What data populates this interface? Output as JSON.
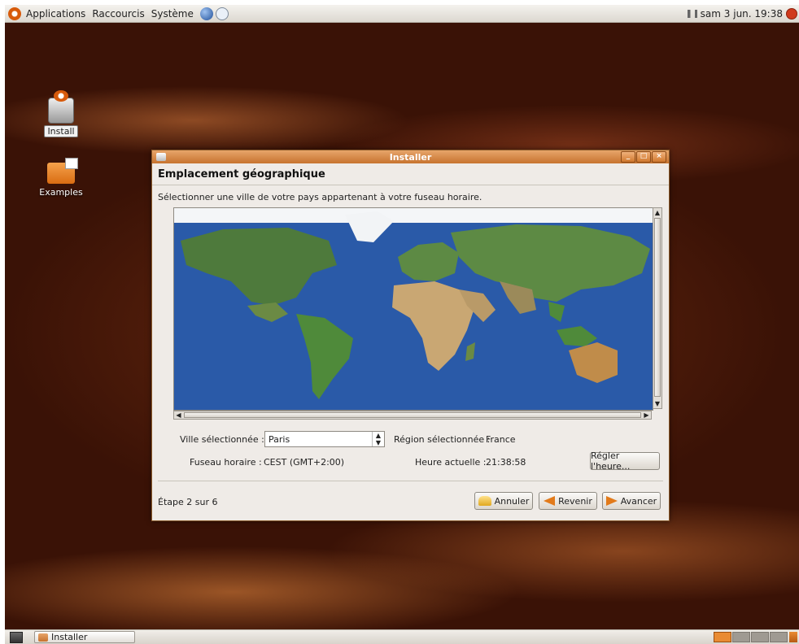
{
  "top_panel": {
    "menus": [
      "Applications",
      "Raccourcis",
      "Système"
    ],
    "clock": "sam  3 jun. 19:38"
  },
  "desktop": {
    "icons": [
      {
        "label": "Install"
      },
      {
        "label": "Examples"
      }
    ]
  },
  "window": {
    "title": "Installer",
    "heading": "Emplacement géographique",
    "instruction": "Sélectionner une ville de votre pays appartenant à votre fuseau horaire.",
    "city_label": "Ville sélectionnée :",
    "city_value": "Paris",
    "region_label": "Région sélectionnée :",
    "region_value": "France",
    "timezone_label": "Fuseau horaire :",
    "timezone_value": "CEST (GMT+2:00)",
    "time_label": "Heure actuelle :",
    "time_value": "21:38:58",
    "set_time_button": "Régler l'heure...",
    "step": "Étape 2 sur 6",
    "cancel_button": "Annuler",
    "back_button": "Revenir",
    "forward_button": "Avancer"
  },
  "bottom_panel": {
    "task_label": "Installer"
  },
  "colors": {
    "accent": "#d0782e",
    "ocean": "#2a5aa8",
    "desktop": "#4a180a"
  }
}
